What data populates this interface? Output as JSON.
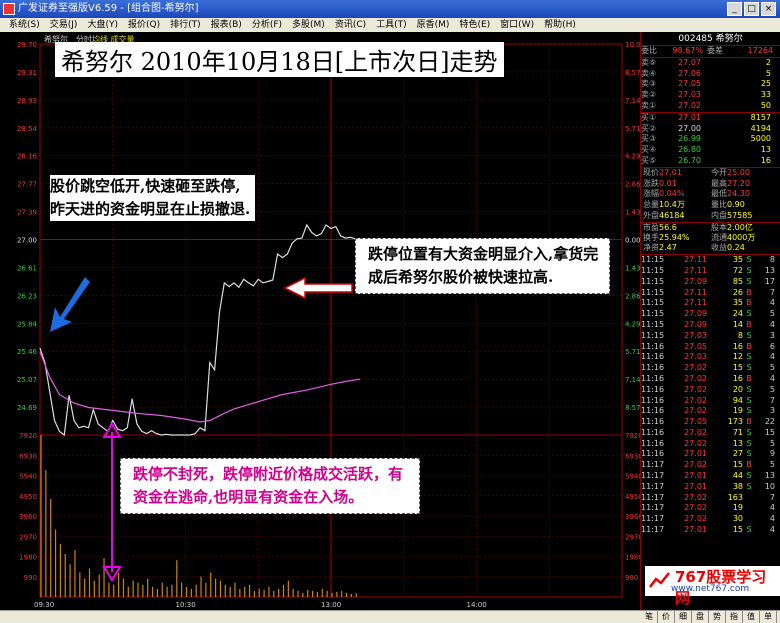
{
  "window": {
    "title": "广发证券至强版V6.59 - [组合图-希努尔]",
    "buttons": [
      "_",
      "□",
      "×"
    ]
  },
  "menu": [
    "系统(S)",
    "交易(J)",
    "大盘(Y)",
    "报价(Q)",
    "排行(T)",
    "报表(B)",
    "分析(F)",
    "多股(M)",
    "资讯(C)",
    "工具(T)",
    "原香(M)",
    "特色(E)",
    "窗口(W)",
    "帮助(H)"
  ],
  "chart_header": {
    "stock": "希努尔",
    "mode": "分时",
    "overlay": "均线 成交量"
  },
  "annotations": {
    "title": "希努尔 2010年10月18日[上市次日]走势",
    "left": "股价跳空低开,快速砸至跌停,昨天进的资金明显在止损撤退.",
    "right": "跌停位置有大资金明显介入,拿货完成后希努尔股价被快速拉高.",
    "bottom": "跌停不封死，跌停附近价格成交活跃，有资金在逃命,也明显有资金在入场。"
  },
  "chart_data": {
    "type": "line",
    "title": "",
    "price_axis": {
      "left_ticks": [
        "29.70",
        "29.31",
        "28.93",
        "28.54",
        "28.16",
        "27.77",
        "27.39",
        "27.00",
        "26.61",
        "26.23",
        "25.84",
        "25.46",
        "25.07",
        "24.69"
      ],
      "right_ticks": [
        "10.00%",
        "8.57%",
        "7.14%",
        "5.71%",
        "4.29%",
        "2.86%",
        "1.43%",
        "0.00%",
        "1.43%",
        "2.86%",
        "4.29%",
        "5.71%",
        "7.14%",
        "8.57%"
      ],
      "ylim": [
        24.3,
        29.7
      ],
      "prev_close": 27.0
    },
    "volume_axis": {
      "ticks": [
        "7920",
        "6930",
        "5940",
        "4950",
        "3960",
        "2970",
        "1980",
        "990"
      ],
      "ylim": [
        0,
        7920
      ]
    },
    "time_axis": {
      "labels": [
        "09:30",
        "10:30",
        "13:00",
        "14:00"
      ]
    },
    "price_series": {
      "name": "价格",
      "x": [
        0,
        2,
        4,
        6,
        8,
        10,
        12,
        14,
        16,
        18,
        20,
        22,
        24,
        26,
        28,
        30,
        32,
        34,
        36,
        38,
        40,
        42,
        44,
        46,
        48,
        50,
        52,
        54,
        56,
        58,
        60,
        62,
        64,
        66,
        68,
        70,
        72,
        74,
        76,
        78,
        80,
        82,
        84,
        86,
        88,
        90,
        92,
        94,
        96,
        98,
        100,
        102,
        104,
        106,
        108,
        110,
        112,
        114,
        116,
        118,
        120,
        122,
        124,
        126,
        128,
        130,
        132
      ],
      "y": [
        25.5,
        25.3,
        24.9,
        24.5,
        24.35,
        24.3,
        24.85,
        24.5,
        24.4,
        24.42,
        24.4,
        24.65,
        24.45,
        24.4,
        24.35,
        24.5,
        24.38,
        24.36,
        24.4,
        24.8,
        24.45,
        24.35,
        24.32,
        24.36,
        24.32,
        24.3,
        24.31,
        24.3,
        24.3,
        24.3,
        24.3,
        24.3,
        24.32,
        24.4,
        24.36,
        25.3,
        25.2,
        26.0,
        26.4,
        26.35,
        26.4,
        26.34,
        26.45,
        26.4,
        26.36,
        26.45,
        26.4,
        26.42,
        26.44,
        26.8,
        26.75,
        26.8,
        26.95,
        27.01,
        27.02,
        27.2,
        27.1,
        27.05,
        27.08,
        27.2,
        27.15,
        27.18,
        27.05,
        27.02,
        27.03,
        27.01,
        27.01
      ]
    },
    "avg_series": {
      "name": "均价",
      "x": [
        0,
        4,
        8,
        14,
        20,
        30,
        40,
        50,
        60,
        66,
        70,
        76,
        80,
        86,
        92,
        100,
        110,
        120,
        126,
        132
      ],
      "y": [
        25.45,
        25.1,
        24.86,
        24.74,
        24.68,
        24.64,
        24.6,
        24.57,
        24.52,
        24.48,
        24.5,
        24.6,
        24.66,
        24.72,
        24.78,
        24.86,
        24.92,
        25.0,
        25.04,
        25.07
      ]
    },
    "volume_series": {
      "name": "成交量",
      "values": [
        7920,
        6200,
        4800,
        3300,
        2600,
        2100,
        1600,
        2300,
        1200,
        900,
        1400,
        800,
        1100,
        1900,
        700,
        600,
        1200,
        900,
        500,
        800,
        700,
        600,
        900,
        500,
        400,
        700,
        500,
        600,
        1800,
        700,
        500,
        400,
        600,
        1000,
        700,
        1200,
        900,
        800,
        600,
        500,
        700,
        400,
        500,
        600,
        300,
        400,
        350,
        500,
        300,
        400,
        600,
        800,
        400,
        300,
        200,
        350,
        300,
        250,
        400,
        300,
        200,
        250,
        300,
        200,
        150,
        180
      ]
    }
  },
  "right_panel": {
    "code": "002485 希努尔",
    "weibi": {
      "label": "委比",
      "value": "98.67%",
      "label2": "委差",
      "value2": "17264"
    },
    "sell": [
      {
        "label": "卖⑤",
        "price": "27.07",
        "vol": "2"
      },
      {
        "label": "卖④",
        "price": "27.06",
        "vol": "5"
      },
      {
        "label": "卖③",
        "price": "27.05",
        "vol": "25"
      },
      {
        "label": "卖②",
        "price": "27.03",
        "vol": "33"
      },
      {
        "label": "卖①",
        "price": "27.02",
        "vol": "50"
      }
    ],
    "buy": [
      {
        "label": "买①",
        "price": "27.01",
        "vol": "8157"
      },
      {
        "label": "买②",
        "price": "27.00",
        "vol": "4194"
      },
      {
        "label": "买③",
        "price": "26.99",
        "vol": "5000"
      },
      {
        "label": "买④",
        "price": "26.80",
        "vol": "13"
      },
      {
        "label": "买⑤",
        "price": "26.70",
        "vol": "16"
      }
    ],
    "stats": [
      [
        {
          "k": "现价",
          "v": "27.01"
        },
        {
          "k": "今开",
          "v": "25.00"
        }
      ],
      [
        {
          "k": "涨跌",
          "v": "0.01"
        },
        {
          "k": "最高",
          "v": "27.20"
        }
      ],
      [
        {
          "k": "涨幅",
          "v": "0.04%"
        },
        {
          "k": "最低",
          "v": "24.30"
        }
      ],
      [
        {
          "k": "总量",
          "v": "10.4万"
        },
        {
          "k": "量比",
          "v": "0.90"
        }
      ],
      [
        {
          "k": "外盘",
          "v": "46184"
        },
        {
          "k": "内盘",
          "v": "57585"
        }
      ],
      [
        {
          "k": "市盈",
          "v": "56.6"
        },
        {
          "k": "股本",
          "v": "2.00亿"
        }
      ],
      [
        {
          "k": "换手",
          "v": "25.94%"
        },
        {
          "k": "流通",
          "v": "4000万"
        }
      ],
      [
        {
          "k": "净资",
          "v": "2.47"
        },
        {
          "k": "收益",
          "v": "0.24"
        }
      ]
    ],
    "ticks": [
      {
        "t": "11:15",
        "p": "27.11",
        "v": "35",
        "d": "S",
        "n": "8"
      },
      {
        "t": "11:15",
        "p": "27.11",
        "v": "72",
        "d": "S",
        "n": "13"
      },
      {
        "t": "11:15",
        "p": "27.09",
        "v": "85",
        "d": "S",
        "n": "17"
      },
      {
        "t": "11:15",
        "p": "27.11",
        "v": "26",
        "d": "B",
        "n": "7"
      },
      {
        "t": "11:15",
        "p": "27.11",
        "v": "35",
        "d": "B",
        "n": "4"
      },
      {
        "t": "11:15",
        "p": "27.09",
        "v": "24",
        "d": "S",
        "n": "5"
      },
      {
        "t": "11:15",
        "p": "27.09",
        "v": "14",
        "d": "B",
        "n": "4"
      },
      {
        "t": "11:15",
        "p": "27.03",
        "v": "8",
        "d": "S",
        "n": "3"
      },
      {
        "t": "11:16",
        "p": "27.05",
        "v": "16",
        "d": "B",
        "n": "6"
      },
      {
        "t": "11:16",
        "p": "27.03",
        "v": "12",
        "d": "S",
        "n": "4"
      },
      {
        "t": "11:16",
        "p": "27.02",
        "v": "15",
        "d": "S",
        "n": "5"
      },
      {
        "t": "11:16",
        "p": "27.02",
        "v": "16",
        "d": "B",
        "n": "4"
      },
      {
        "t": "11:16",
        "p": "27.02",
        "v": "20",
        "d": "S",
        "n": "5"
      },
      {
        "t": "11:16",
        "p": "27.02",
        "v": "94",
        "d": "S",
        "n": "7"
      },
      {
        "t": "11:16",
        "p": "27.02",
        "v": "19",
        "d": "S",
        "n": "3"
      },
      {
        "t": "11:16",
        "p": "27.05",
        "v": "173",
        "d": "B",
        "n": "22"
      },
      {
        "t": "11:16",
        "p": "27.02",
        "v": "71",
        "d": "S",
        "n": "15"
      },
      {
        "t": "11:16",
        "p": "27.02",
        "v": "13",
        "d": "S",
        "n": "5"
      },
      {
        "t": "11:16",
        "p": "27.01",
        "v": "27",
        "d": "S",
        "n": "9"
      },
      {
        "t": "11:17",
        "p": "27.02",
        "v": "15",
        "d": "B",
        "n": "5"
      },
      {
        "t": "11:17",
        "p": "27.01",
        "v": "44",
        "d": "S",
        "n": "13"
      },
      {
        "t": "11:17",
        "p": "27.01",
        "v": "38",
        "d": "S",
        "n": "10"
      },
      {
        "t": "11:17",
        "p": "27.02",
        "v": "163",
        "d": "",
        "n": "7"
      },
      {
        "t": "11:17",
        "p": "27.02",
        "v": "19",
        "d": "",
        "n": "4"
      },
      {
        "t": "11:17",
        "p": "27.02",
        "v": "30",
        "d": "",
        "n": "4"
      },
      {
        "t": "11:17",
        "p": "27.01",
        "v": "15",
        "d": "S",
        "n": "4"
      }
    ]
  },
  "logo": {
    "text": "767股票学习网",
    "url": "www.net767.com"
  },
  "bottom_tabs": [
    "笔",
    "价",
    "细",
    "盘",
    "势",
    "指",
    "值",
    "单"
  ]
}
